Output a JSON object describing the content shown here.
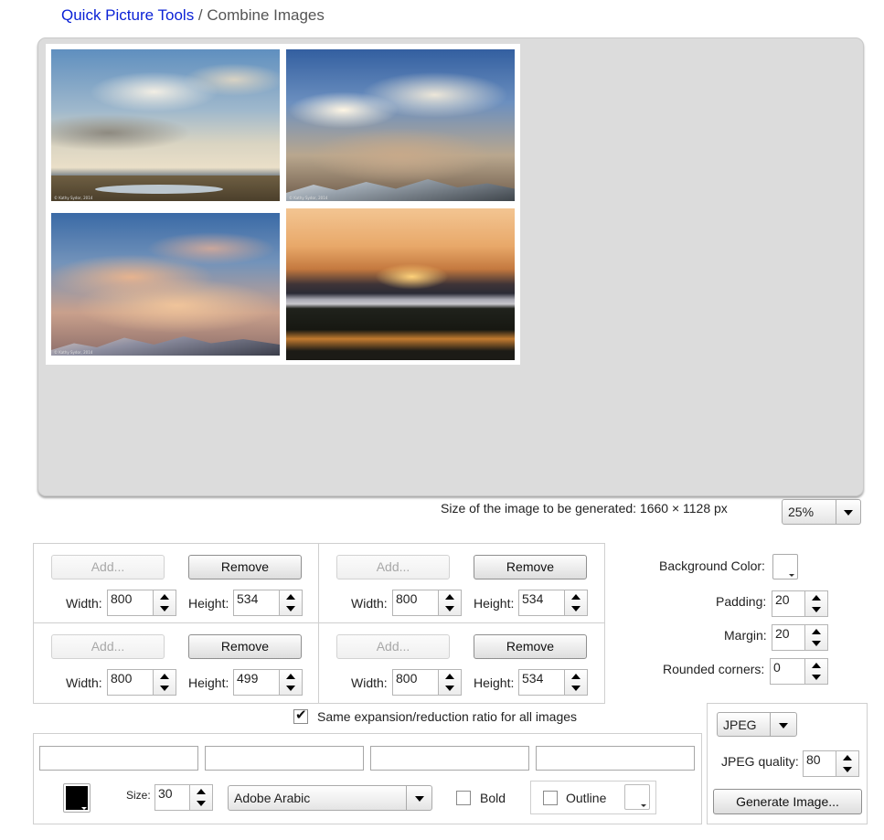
{
  "breadcrumb": {
    "link": "Quick Picture Tools",
    "separator": " / ",
    "current": "Combine Images"
  },
  "preview": {
    "watermark": "© Kathy Sydor, 2014"
  },
  "size_info": {
    "label": "Size of the image to be generated: 1660 × 1128 px"
  },
  "zoom": {
    "value": "25%"
  },
  "images": [
    {
      "add_label": "Add...",
      "remove_label": "Remove",
      "width_label": "Width:",
      "width": "800",
      "height_label": "Height:",
      "height": "534"
    },
    {
      "add_label": "Add...",
      "remove_label": "Remove",
      "width_label": "Width:",
      "width": "800",
      "height_label": "Height:",
      "height": "534"
    },
    {
      "add_label": "Add...",
      "remove_label": "Remove",
      "width_label": "Width:",
      "width": "800",
      "height_label": "Height:",
      "height": "499"
    },
    {
      "add_label": "Add...",
      "remove_label": "Remove",
      "width_label": "Width:",
      "width": "800",
      "height_label": "Height:",
      "height": "534"
    }
  ],
  "settings": {
    "background_color_label": "Background Color:",
    "background_color": "#ffffff",
    "padding_label": "Padding:",
    "padding": "20",
    "margin_label": "Margin:",
    "margin": "20",
    "rounded_corners_label": "Rounded corners:",
    "rounded_corners": "0"
  },
  "same_ratio": {
    "label": "Same expansion/reduction ratio for all images",
    "checked": true
  },
  "text": {
    "boxes": [
      "",
      "",
      "",
      ""
    ],
    "color": "#000000",
    "size_label": "Size:",
    "size": "30",
    "font": "Adobe Arabic",
    "bold_label": "Bold",
    "bold": false,
    "outline_label": "Outline",
    "outline": false,
    "outline_color": "#ffffff"
  },
  "output": {
    "format": "JPEG",
    "quality_label": "JPEG quality:",
    "quality": "80",
    "generate_label": "Generate Image..."
  },
  "colors": {
    "link": "#0b22d6",
    "preview_bg": "#dcdcdc",
    "border": "#cfcfcf"
  },
  "icons": {
    "spinner_up": "triangle-up",
    "spinner_down": "triangle-down",
    "dropdown": "triangle-down",
    "checkbox_check": "check-mark"
  }
}
